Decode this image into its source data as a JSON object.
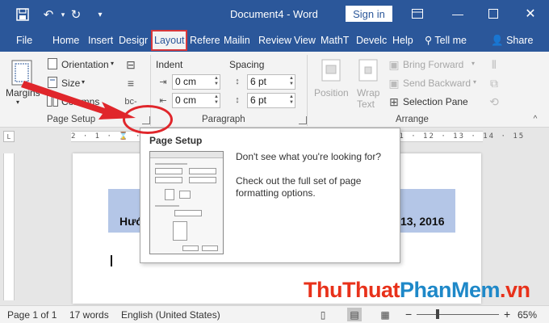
{
  "window": {
    "title": "Document4 - Word",
    "sign_in": "Sign in",
    "icons": [
      "save-icon",
      "undo-icon",
      "redo-icon",
      "customize-icon",
      "ribbon-display-icon",
      "minimize-icon",
      "maximize-icon",
      "close-icon"
    ]
  },
  "tabs": [
    "File",
    "Home",
    "Insert",
    "Design",
    "Layout",
    "References",
    "Mailings",
    "Review",
    "View",
    "MathType",
    "Developer",
    "Help"
  ],
  "tabs_visible": [
    "File",
    "Home",
    "Insert",
    "Desigr",
    "Layout",
    "Refere",
    "Mailin",
    "Review",
    "View",
    "MathT",
    "Develc",
    "Help"
  ],
  "active_tab": "Layout",
  "tell_me": "Tell me",
  "share": "Share",
  "ribbon": {
    "page_setup": {
      "margins": "Margins",
      "orientation": "Orientation",
      "size": "Size",
      "columns": "Columns",
      "group_label": "Page Setup"
    },
    "paragraph": {
      "indent_label": "Indent",
      "spacing_label": "Spacing",
      "indent_left": "0 cm",
      "indent_right": "0 cm",
      "spacing_before": "6 pt",
      "spacing_after": "6 pt",
      "group_label": "Paragraph"
    },
    "arrange": {
      "position": "Position",
      "wrap": "Wrap",
      "text": "Text",
      "bring_forward": "Bring Forward",
      "send_backward": "Send Backward",
      "selection_pane": "Selection Pane",
      "group_label": "Arrange"
    }
  },
  "ruler": {
    "numbers": "2 · 1 · ⌛ · 1 · 2 · 3 · 4 · 5 · 6 · 7 · 8 · 9 · 10 · 11 · 12 · 13 · 14 · 15"
  },
  "document": {
    "line_left": "Hướ",
    "line_right": "13, 2016"
  },
  "tooltip": {
    "title": "Page Setup",
    "line1": "Don't see what you're looking for?",
    "line2": "Check out the full set of page formatting options."
  },
  "status": {
    "page": "Page 1 of 1",
    "words": "17 words",
    "language": "English (United States)",
    "zoom_minus": "−",
    "zoom_plus": "+",
    "zoom": "65%",
    "zoom_level_percent": 65
  },
  "watermark": {
    "part1": "ThuThuat",
    "part2": "PhanMem",
    "part3": ".vn"
  },
  "colors": {
    "title_bar": "#2b579a",
    "highlight": "#b4c6e7",
    "annotation_red": "#e0262b"
  }
}
